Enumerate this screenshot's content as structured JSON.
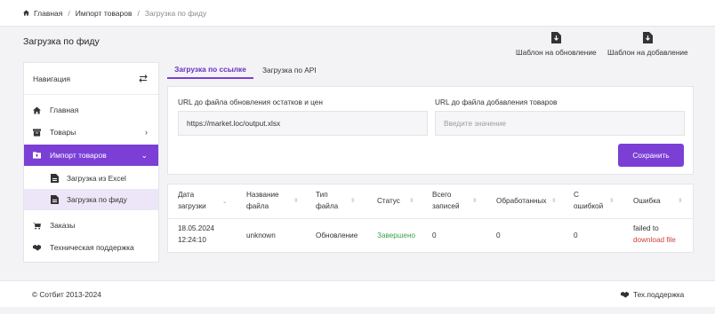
{
  "breadcrumb": {
    "home": "Главная",
    "import": "Импорт товаров",
    "current": "Загрузка по фиду",
    "sep": "/"
  },
  "page": {
    "title": "Загрузка по фиду"
  },
  "templates": {
    "update": "Шаблон на обновление",
    "add": "Шаблон на добавление"
  },
  "sidebar": {
    "title": "Навигация",
    "items": [
      {
        "label": "Главная",
        "icon": "home-icon"
      },
      {
        "label": "Товары",
        "icon": "box-icon"
      },
      {
        "label": "Импорт товаров",
        "icon": "upload-folder-icon"
      },
      {
        "label": "Заказы",
        "icon": "cart-icon"
      },
      {
        "label": "Техническая поддержка",
        "icon": "handshake-icon"
      }
    ],
    "sub": [
      {
        "label": "Загрузка из Excel",
        "icon": "file-icon"
      },
      {
        "label": "Загрузка по фиду",
        "icon": "file-icon"
      }
    ]
  },
  "tabs": {
    "by_link": "Загрузка по ссылке",
    "by_api": "Загрузка по API"
  },
  "form": {
    "update_label": "URL до файла обновления остатков и цен",
    "update_value": "https://market.loc/output.xlsx",
    "add_label": "URL до файла добавления товаров",
    "add_placeholder": "Введите значение",
    "save": "Сохранить"
  },
  "table": {
    "headers": [
      [
        "Дата",
        "загрузки"
      ],
      [
        "Название",
        "файла"
      ],
      [
        "Тип",
        "файла"
      ],
      [
        "Статус"
      ],
      [
        "Всего",
        "записей"
      ],
      [
        "Обработанных"
      ],
      [
        "С",
        "ошибкой"
      ],
      [
        "Ошибка"
      ]
    ],
    "row": {
      "date": "18.05.2024",
      "time": "12:24:10",
      "name": "unknown",
      "type": "Обновление",
      "status": "Завершено",
      "total": "0",
      "processed": "0",
      "errors": "0",
      "error_text": "failed to",
      "error_link": "download file"
    }
  },
  "footer": {
    "copyright": "© Сотбит 2013-2024",
    "support": "Тех.поддержка"
  },
  "colors": {
    "accent": "#7b3fd6",
    "success": "#3aa24a",
    "danger": "#d23c3c"
  }
}
